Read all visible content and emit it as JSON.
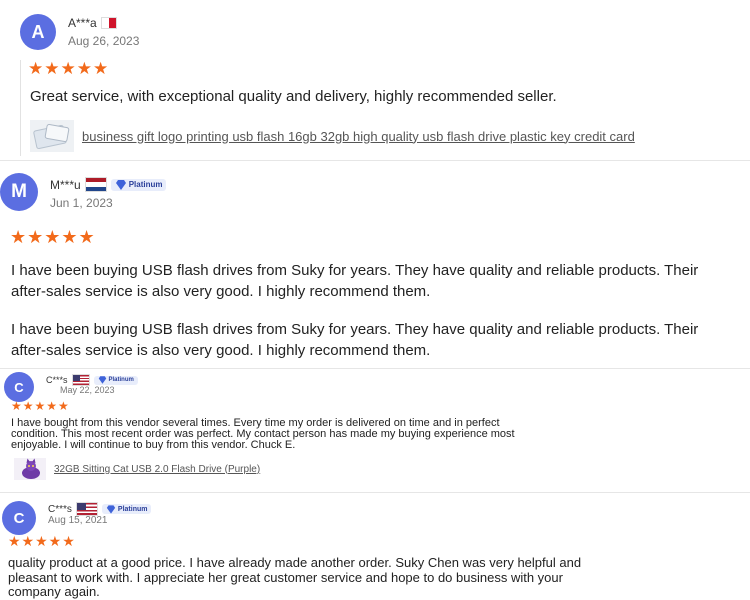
{
  "reviews": [
    {
      "avatar_letter": "A",
      "name": "A***a",
      "date": "Aug 26, 2023",
      "stars": "★★★★★",
      "text": "Great service, with exceptional quality and delivery, highly recommended seller.",
      "product": "business gift logo printing usb flash 16gb 32gb high quality usb flash drive plastic key credit card"
    },
    {
      "avatar_letter": "M",
      "name": "M***u",
      "badge": "Platinum",
      "date": "Jun 1, 2023",
      "stars": "★★★★★",
      "text_line1": "I have been buying USB flash drives from Suky for years. They have quality and reliable products. Their",
      "text_line2": "after-sales service is also very good. I highly recommend them.",
      "text2_line1": "I have been buying USB flash drives from Suky for years. They have quality and reliable products. Their",
      "text2_line2": "after-sales service is also very good. I highly recommend them."
    },
    {
      "avatar_letter": "C",
      "name": "C***s",
      "badge": "Platinum",
      "date": "May 22, 2023",
      "stars": "★★★★★",
      "text_line1": "I have bought from this vendor several times. Every time my order is delivered on time and in perfect",
      "text_line2": "condition. This most recent order was perfect. My contact person has made my buying experience most",
      "text_line3": "enjoyable. I will continue to buy from this vendor. Chuck E.",
      "product": "32GB Sitting Cat USB 2.0 Flash Drive (Purple)"
    },
    {
      "avatar_letter": "C",
      "name": "C***s",
      "badge": "Platinum",
      "date": "Aug 15, 2021",
      "stars": "★★★★★",
      "text_line1": "quality product at a good price. I have already made another order. Suky Chen was very helpful and",
      "text_line2": "pleasant to work with. I appreciate her great customer service and hope to do business with your",
      "text_line3": "company again."
    }
  ]
}
